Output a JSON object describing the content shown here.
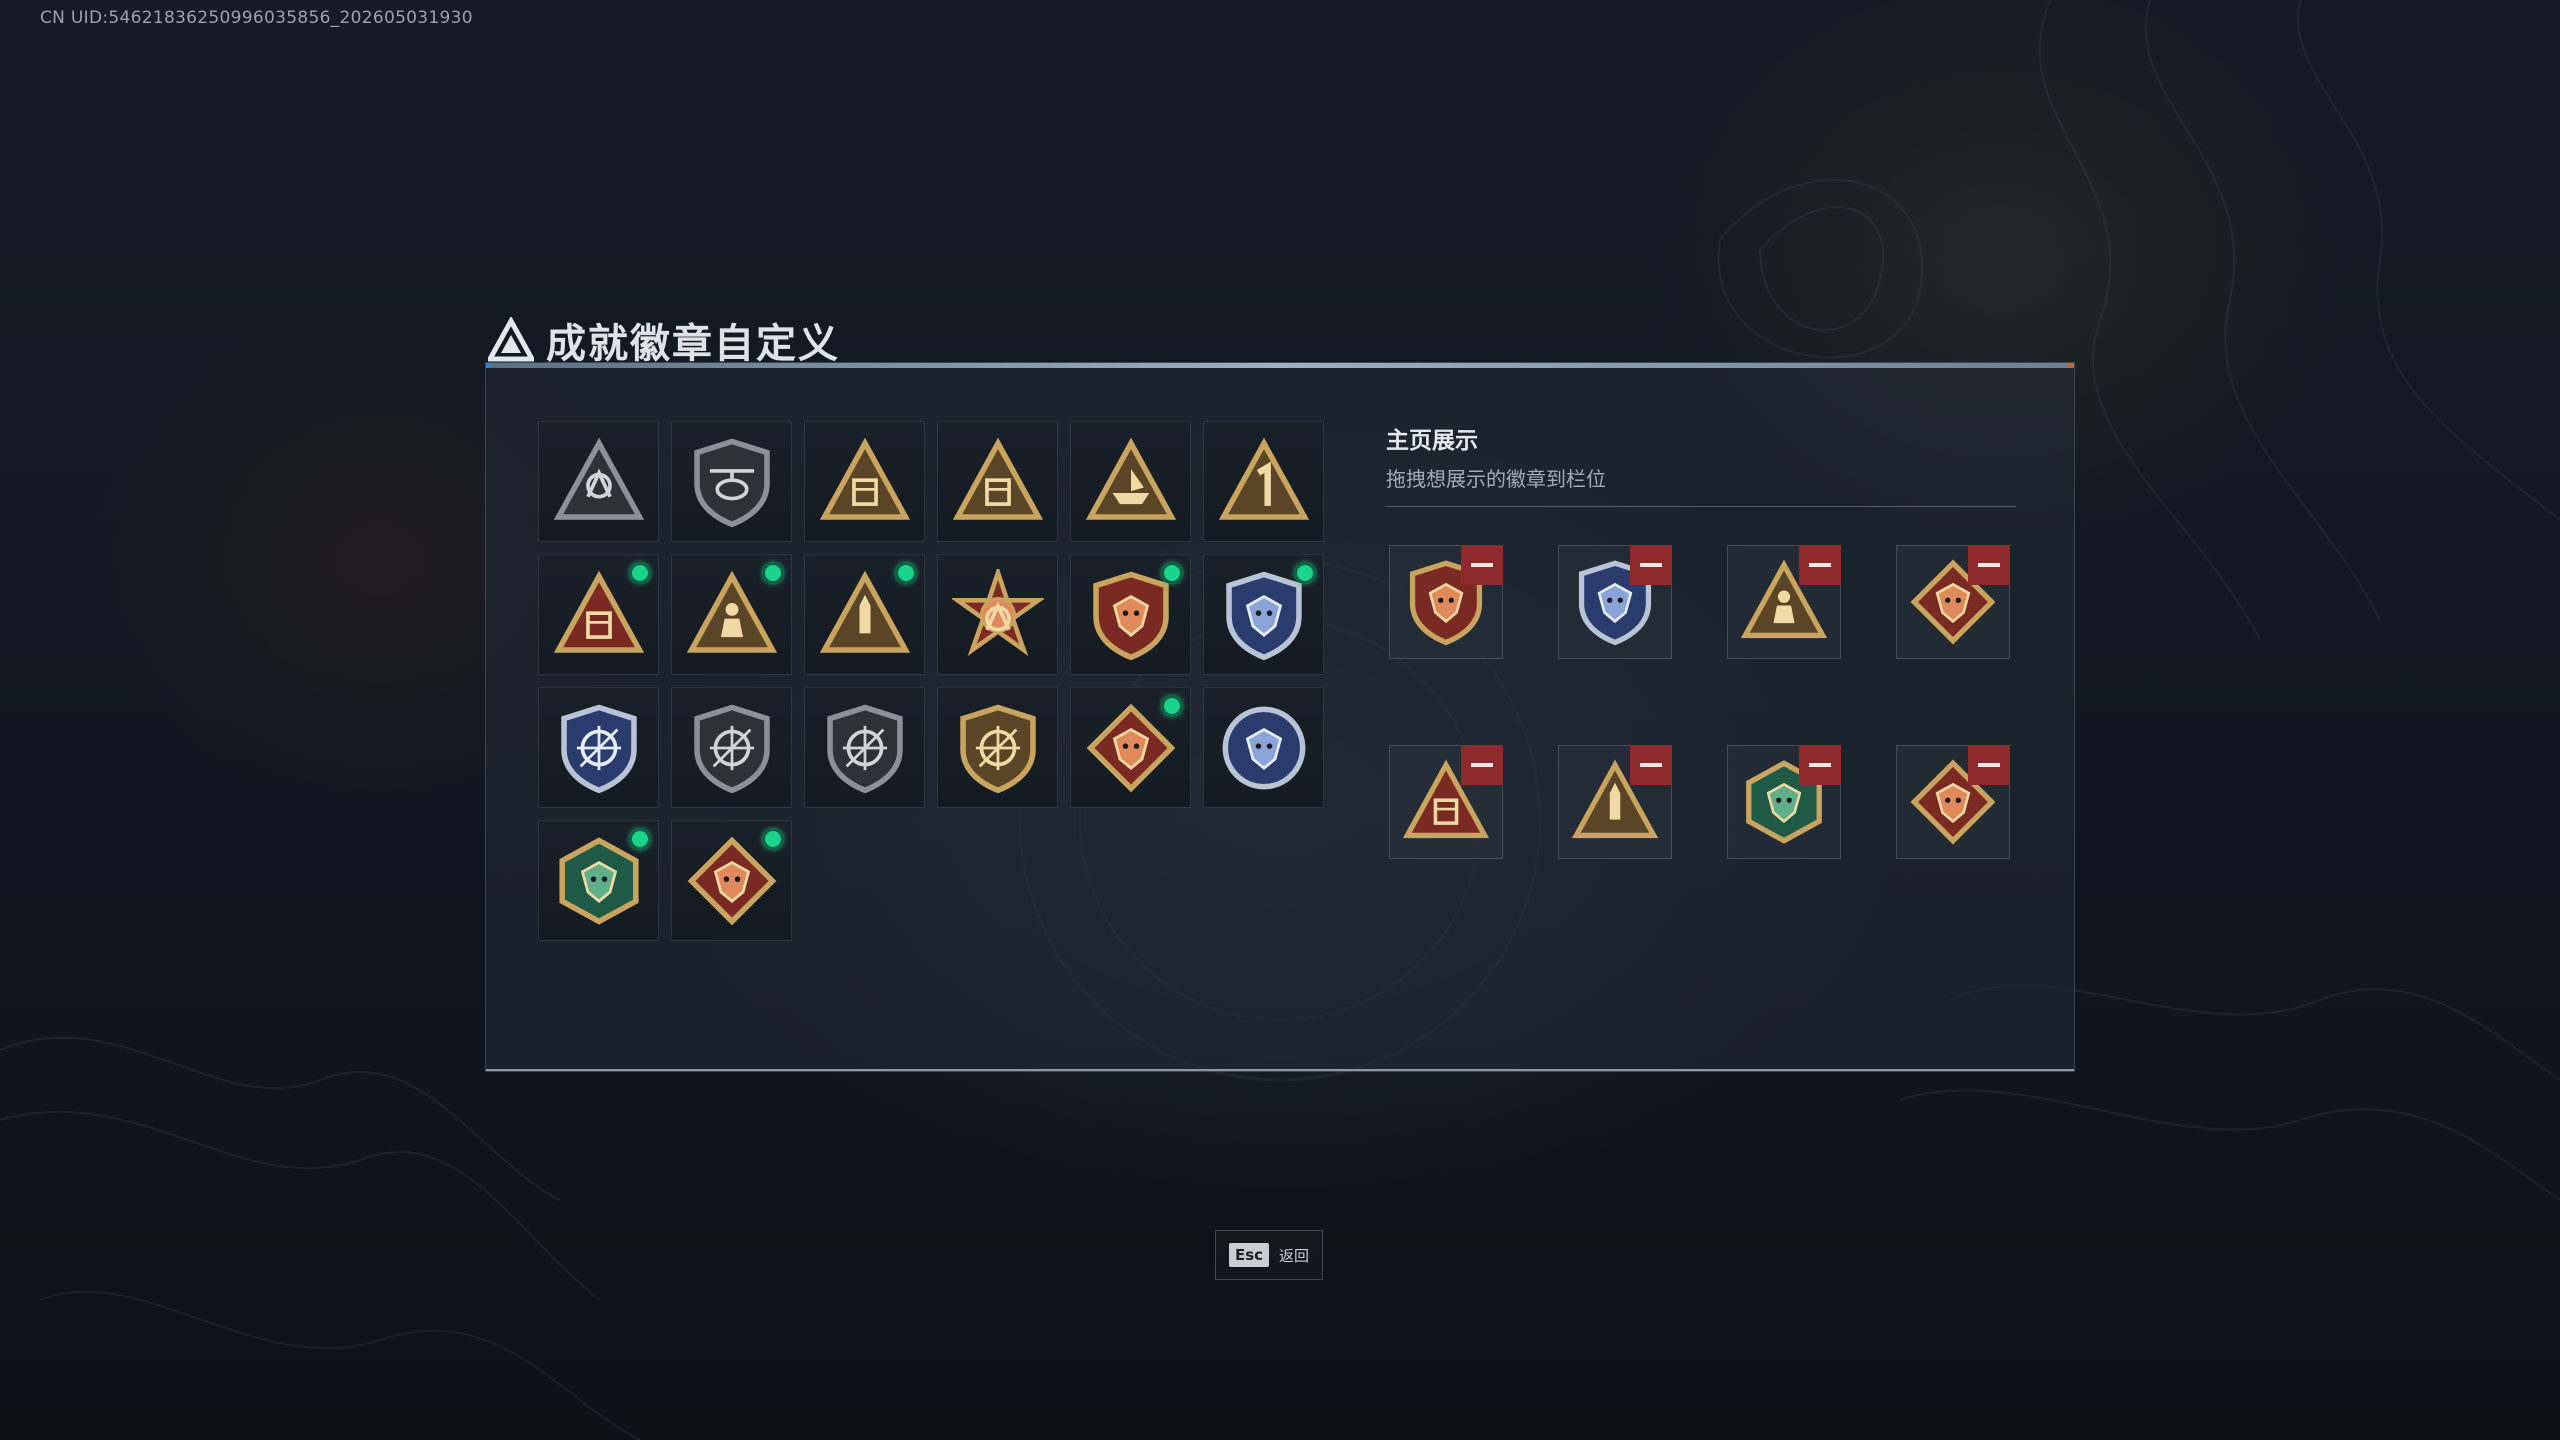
{
  "uid_text": "CN UID:54621836250996035856_202605031930",
  "title": "成就徽章自定义",
  "title_tag": "",
  "colors": {
    "accent_blue": "#2f7de0",
    "new_dot": "#19d48a",
    "remove": "#8e2a2c"
  },
  "badges": [
    {
      "icon": "shield-triangle-badge-icon",
      "style": "dark",
      "new": false
    },
    {
      "icon": "helicopter-badge-icon",
      "style": "dark",
      "new": false
    },
    {
      "icon": "crate-triangle-badge-icon",
      "style": "gold",
      "new": false
    },
    {
      "icon": "crate-58-triangle-badge-icon",
      "style": "gold",
      "new": false
    },
    {
      "icon": "boat-triangle-badge-icon",
      "style": "gold",
      "new": false
    },
    {
      "icon": "number-one-triangle-badge-icon",
      "style": "gold",
      "new": false
    },
    {
      "icon": "red-crate-triangle-badge-icon",
      "style": "red",
      "new": true
    },
    {
      "icon": "soldier-triangle-badge-icon",
      "style": "gold",
      "new": true
    },
    {
      "icon": "missile-triangle-badge-icon",
      "style": "gold",
      "new": true
    },
    {
      "icon": "star-medal-badge-icon",
      "style": "red",
      "new": false
    },
    {
      "icon": "red-eagle-shield-badge-icon",
      "style": "red",
      "new": true
    },
    {
      "icon": "blue-eagle-shield-badge-icon",
      "style": "blue",
      "new": true
    },
    {
      "icon": "blue-crosshair-shield-badge-icon",
      "style": "blue",
      "new": false
    },
    {
      "icon": "rifle-shield-badge-icon",
      "style": "dark",
      "new": false
    },
    {
      "icon": "sniper-shield-badge-icon",
      "style": "dark",
      "new": false
    },
    {
      "icon": "gold-crosshair-shield-badge-icon",
      "style": "gold",
      "new": false
    },
    {
      "icon": "wolf-diamond-badge-icon",
      "style": "red",
      "new": true
    },
    {
      "icon": "eagle-circle-badge-icon",
      "style": "blue",
      "new": false
    },
    {
      "icon": "green-dragon-hexagon-badge-icon",
      "style": "green",
      "new": true
    },
    {
      "icon": "red-dragon-diamond-badge-icon",
      "style": "red",
      "new": true
    }
  ],
  "showcase": {
    "title": "主页展示",
    "subtitle": "拖拽想展示的徽章到栏位",
    "slots": [
      {
        "icon": "red-eagle-shield-badge-icon",
        "style": "red"
      },
      {
        "icon": "blue-eagle-shield-badge-icon",
        "style": "blue"
      },
      {
        "icon": "soldier-triangle-badge-icon",
        "style": "gold"
      },
      {
        "icon": "wolf-diamond-badge-icon",
        "style": "red"
      },
      {
        "icon": "red-crate-triangle-badge-icon",
        "style": "red"
      },
      {
        "icon": "missile-triangle-badge-icon",
        "style": "gold"
      },
      {
        "icon": "green-dragon-hexagon-badge-icon",
        "style": "green"
      },
      {
        "icon": "red-dragon-diamond-badge-icon",
        "style": "red"
      }
    ]
  },
  "footer": {
    "esc_key": "Esc",
    "esc_label": "返回"
  }
}
